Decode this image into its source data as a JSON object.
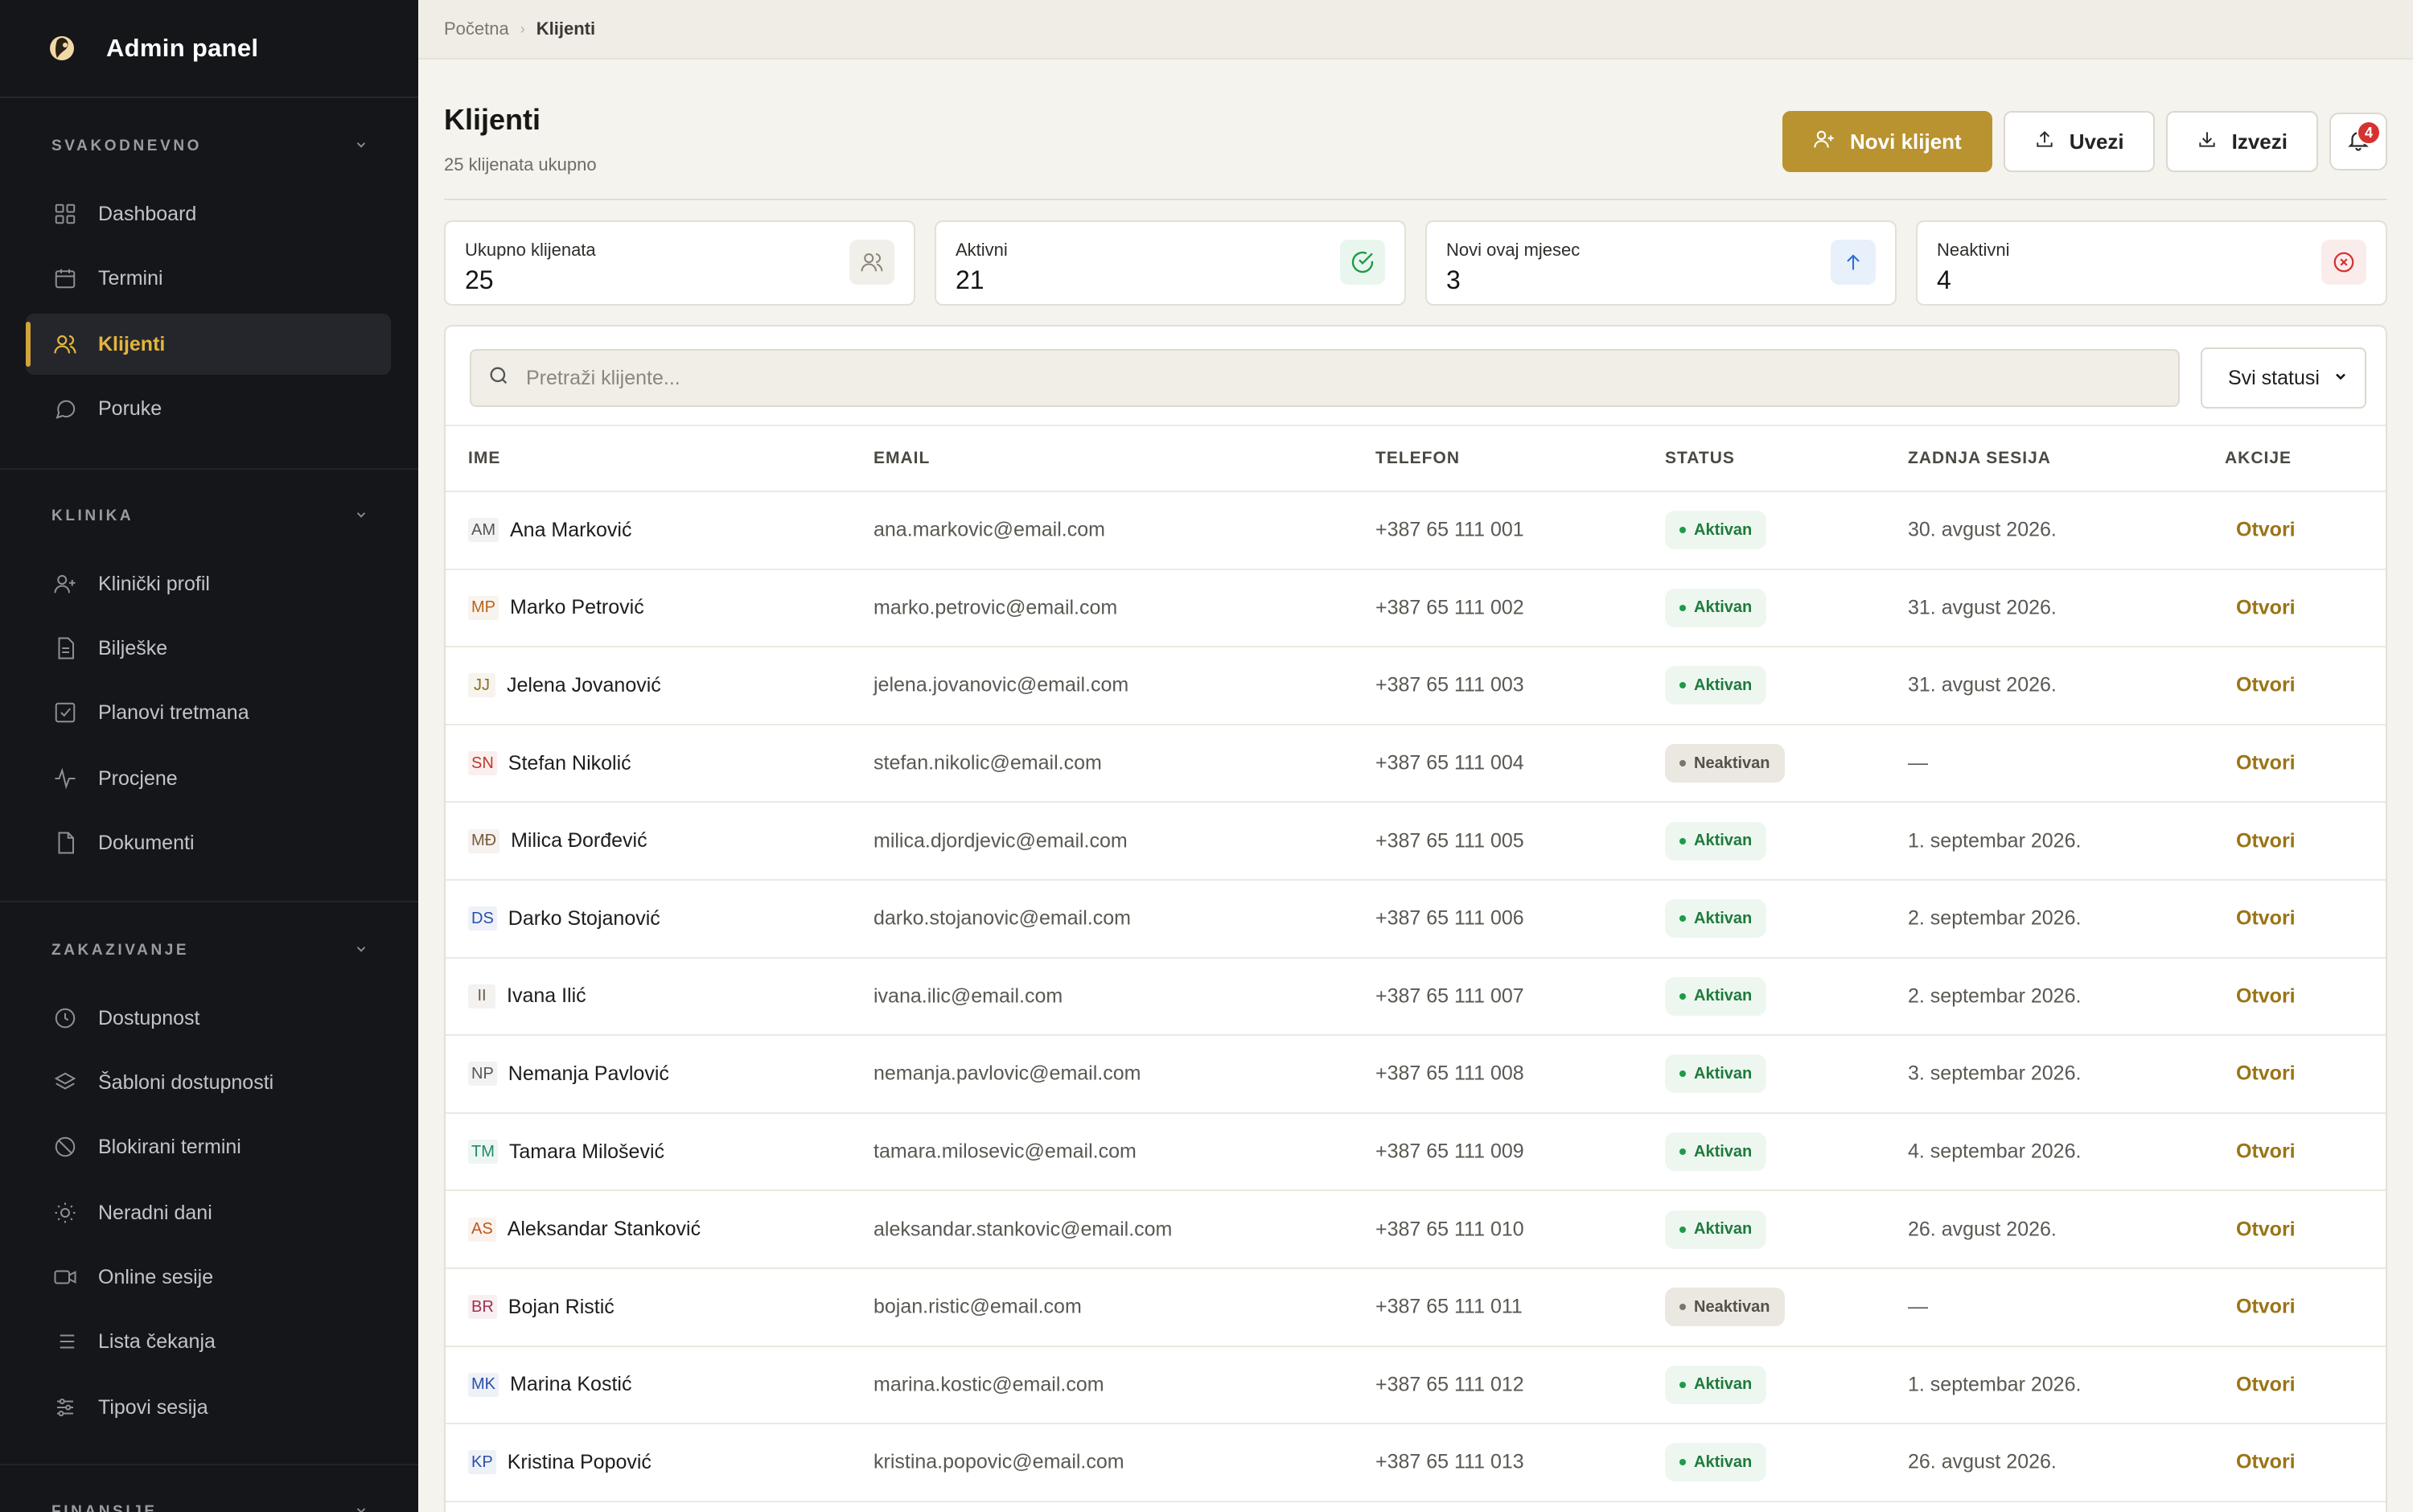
{
  "app": {
    "title": "Admin panel"
  },
  "sidebar": {
    "sections": [
      {
        "label": "SVAKODNEVNO",
        "items": [
          {
            "label": "Dashboard",
            "icon": "grid-icon",
            "active": false
          },
          {
            "label": "Termini",
            "icon": "calendar-icon",
            "active": false
          },
          {
            "label": "Klijenti",
            "icon": "users-icon",
            "active": true
          },
          {
            "label": "Poruke",
            "icon": "chat-icon",
            "active": false
          }
        ]
      },
      {
        "label": "KLINIKA",
        "items": [
          {
            "label": "Klinički profil",
            "icon": "user-plus-icon"
          },
          {
            "label": "Bilješke",
            "icon": "note-icon"
          },
          {
            "label": "Planovi tretmana",
            "icon": "checkbox-icon"
          },
          {
            "label": "Procjene",
            "icon": "activity-icon"
          },
          {
            "label": "Dokumenti",
            "icon": "file-icon"
          }
        ]
      },
      {
        "label": "ZAKAZIVANJE",
        "items": [
          {
            "label": "Dostupnost",
            "icon": "clock-icon"
          },
          {
            "label": "Šabloni dostupnosti",
            "icon": "layers-icon"
          },
          {
            "label": "Blokirani termini",
            "icon": "ban-icon"
          },
          {
            "label": "Neradni dani",
            "icon": "sun-icon"
          },
          {
            "label": "Online sesije",
            "icon": "video-icon"
          },
          {
            "label": "Lista čekanja",
            "icon": "list-icon"
          },
          {
            "label": "Tipovi sesija",
            "icon": "sliders-icon"
          }
        ]
      },
      {
        "label": "FINANSIJE",
        "items": []
      }
    ]
  },
  "breadcrumb": {
    "home": "Početna",
    "current": "Klijenti"
  },
  "page": {
    "title": "Klijenti",
    "subtitle": "25 klijenata ukupno"
  },
  "actions": {
    "new_client": "Novi klijent",
    "import": "Uvezi",
    "export": "Izvezi",
    "notifications_count": "4"
  },
  "stats": [
    {
      "label": "Ukupno klijenata",
      "value": "25",
      "icon": "users-icon",
      "color": "#8a8476"
    },
    {
      "label": "Aktivni",
      "value": "21",
      "icon": "check-circle-icon",
      "color": "#1f9a4a"
    },
    {
      "label": "Novi ovaj mjesec",
      "value": "3",
      "icon": "arrow-up-icon",
      "color": "#2b6fd6"
    },
    {
      "label": "Neaktivni",
      "value": "4",
      "icon": "x-circle-icon",
      "color": "#d63232"
    }
  ],
  "filters": {
    "search_placeholder": "Pretraži klijente...",
    "status_selected": "Svi statusi"
  },
  "table": {
    "columns": [
      "IME",
      "EMAIL",
      "TELEFON",
      "STATUS",
      "ZADNJA SESIJA",
      "AKCIJE"
    ],
    "action_label": "Otvori",
    "rows": [
      {
        "initials": "AM",
        "name": "Ana Marković",
        "email": "ana.markovic@email.com",
        "phone": "+387 65 111 001",
        "status": "Aktivan",
        "active": true,
        "last": "30. avgust 2026.",
        "color": "#555555"
      },
      {
        "initials": "MP",
        "name": "Marko Petrović",
        "email": "marko.petrovic@email.com",
        "phone": "+387 65 111 002",
        "status": "Aktivan",
        "active": true,
        "last": "31. avgust 2026.",
        "color": "#b5651d"
      },
      {
        "initials": "JJ",
        "name": "Jelena Jovanović",
        "email": "jelena.jovanovic@email.com",
        "phone": "+387 65 111 003",
        "status": "Aktivan",
        "active": true,
        "last": "31. avgust 2026.",
        "color": "#8a6d1e"
      },
      {
        "initials": "SN",
        "name": "Stefan Nikolić",
        "email": "stefan.nikolic@email.com",
        "phone": "+387 65 111 004",
        "status": "Neaktivan",
        "active": false,
        "last": "—",
        "color": "#c0392b"
      },
      {
        "initials": "MĐ",
        "name": "Milica Đorđević",
        "email": "milica.djordjevic@email.com",
        "phone": "+387 65 111 005",
        "status": "Aktivan",
        "active": true,
        "last": "1. septembar 2026.",
        "color": "#7a5a3a"
      },
      {
        "initials": "DS",
        "name": "Darko Stojanović",
        "email": "darko.stojanovic@email.com",
        "phone": "+387 65 111 006",
        "status": "Aktivan",
        "active": true,
        "last": "2. septembar 2026.",
        "color": "#2b4fa8"
      },
      {
        "initials": "II",
        "name": "Ivana Ilić",
        "email": "ivana.ilic@email.com",
        "phone": "+387 65 111 007",
        "status": "Aktivan",
        "active": true,
        "last": "2. septembar 2026.",
        "color": "#6b5a4a"
      },
      {
        "initials": "NP",
        "name": "Nemanja Pavlović",
        "email": "nemanja.pavlovic@email.com",
        "phone": "+387 65 111 008",
        "status": "Aktivan",
        "active": true,
        "last": "3. septembar 2026.",
        "color": "#555555"
      },
      {
        "initials": "TM",
        "name": "Tamara Milošević",
        "email": "tamara.milosevic@email.com",
        "phone": "+387 65 111 009",
        "status": "Aktivan",
        "active": true,
        "last": "4. septembar 2026.",
        "color": "#1f8a6a"
      },
      {
        "initials": "AS",
        "name": "Aleksandar Stanković",
        "email": "aleksandar.stankovic@email.com",
        "phone": "+387 65 111 010",
        "status": "Aktivan",
        "active": true,
        "last": "26. avgust 2026.",
        "color": "#c0561d"
      },
      {
        "initials": "BR",
        "name": "Bojan Ristić",
        "email": "bojan.ristic@email.com",
        "phone": "+387 65 111 011",
        "status": "Neaktivan",
        "active": false,
        "last": "—",
        "color": "#a03050"
      },
      {
        "initials": "MK",
        "name": "Marina Kostić",
        "email": "marina.kostic@email.com",
        "phone": "+387 65 111 012",
        "status": "Aktivan",
        "active": true,
        "last": "1. septembar 2026.",
        "color": "#2b4fa8"
      },
      {
        "initials": "KP",
        "name": "Kristina Popović",
        "email": "kristina.popovic@email.com",
        "phone": "+387 65 111 013",
        "status": "Aktivan",
        "active": true,
        "last": "26. avgust 2026.",
        "color": "#2b4fa8"
      }
    ]
  }
}
